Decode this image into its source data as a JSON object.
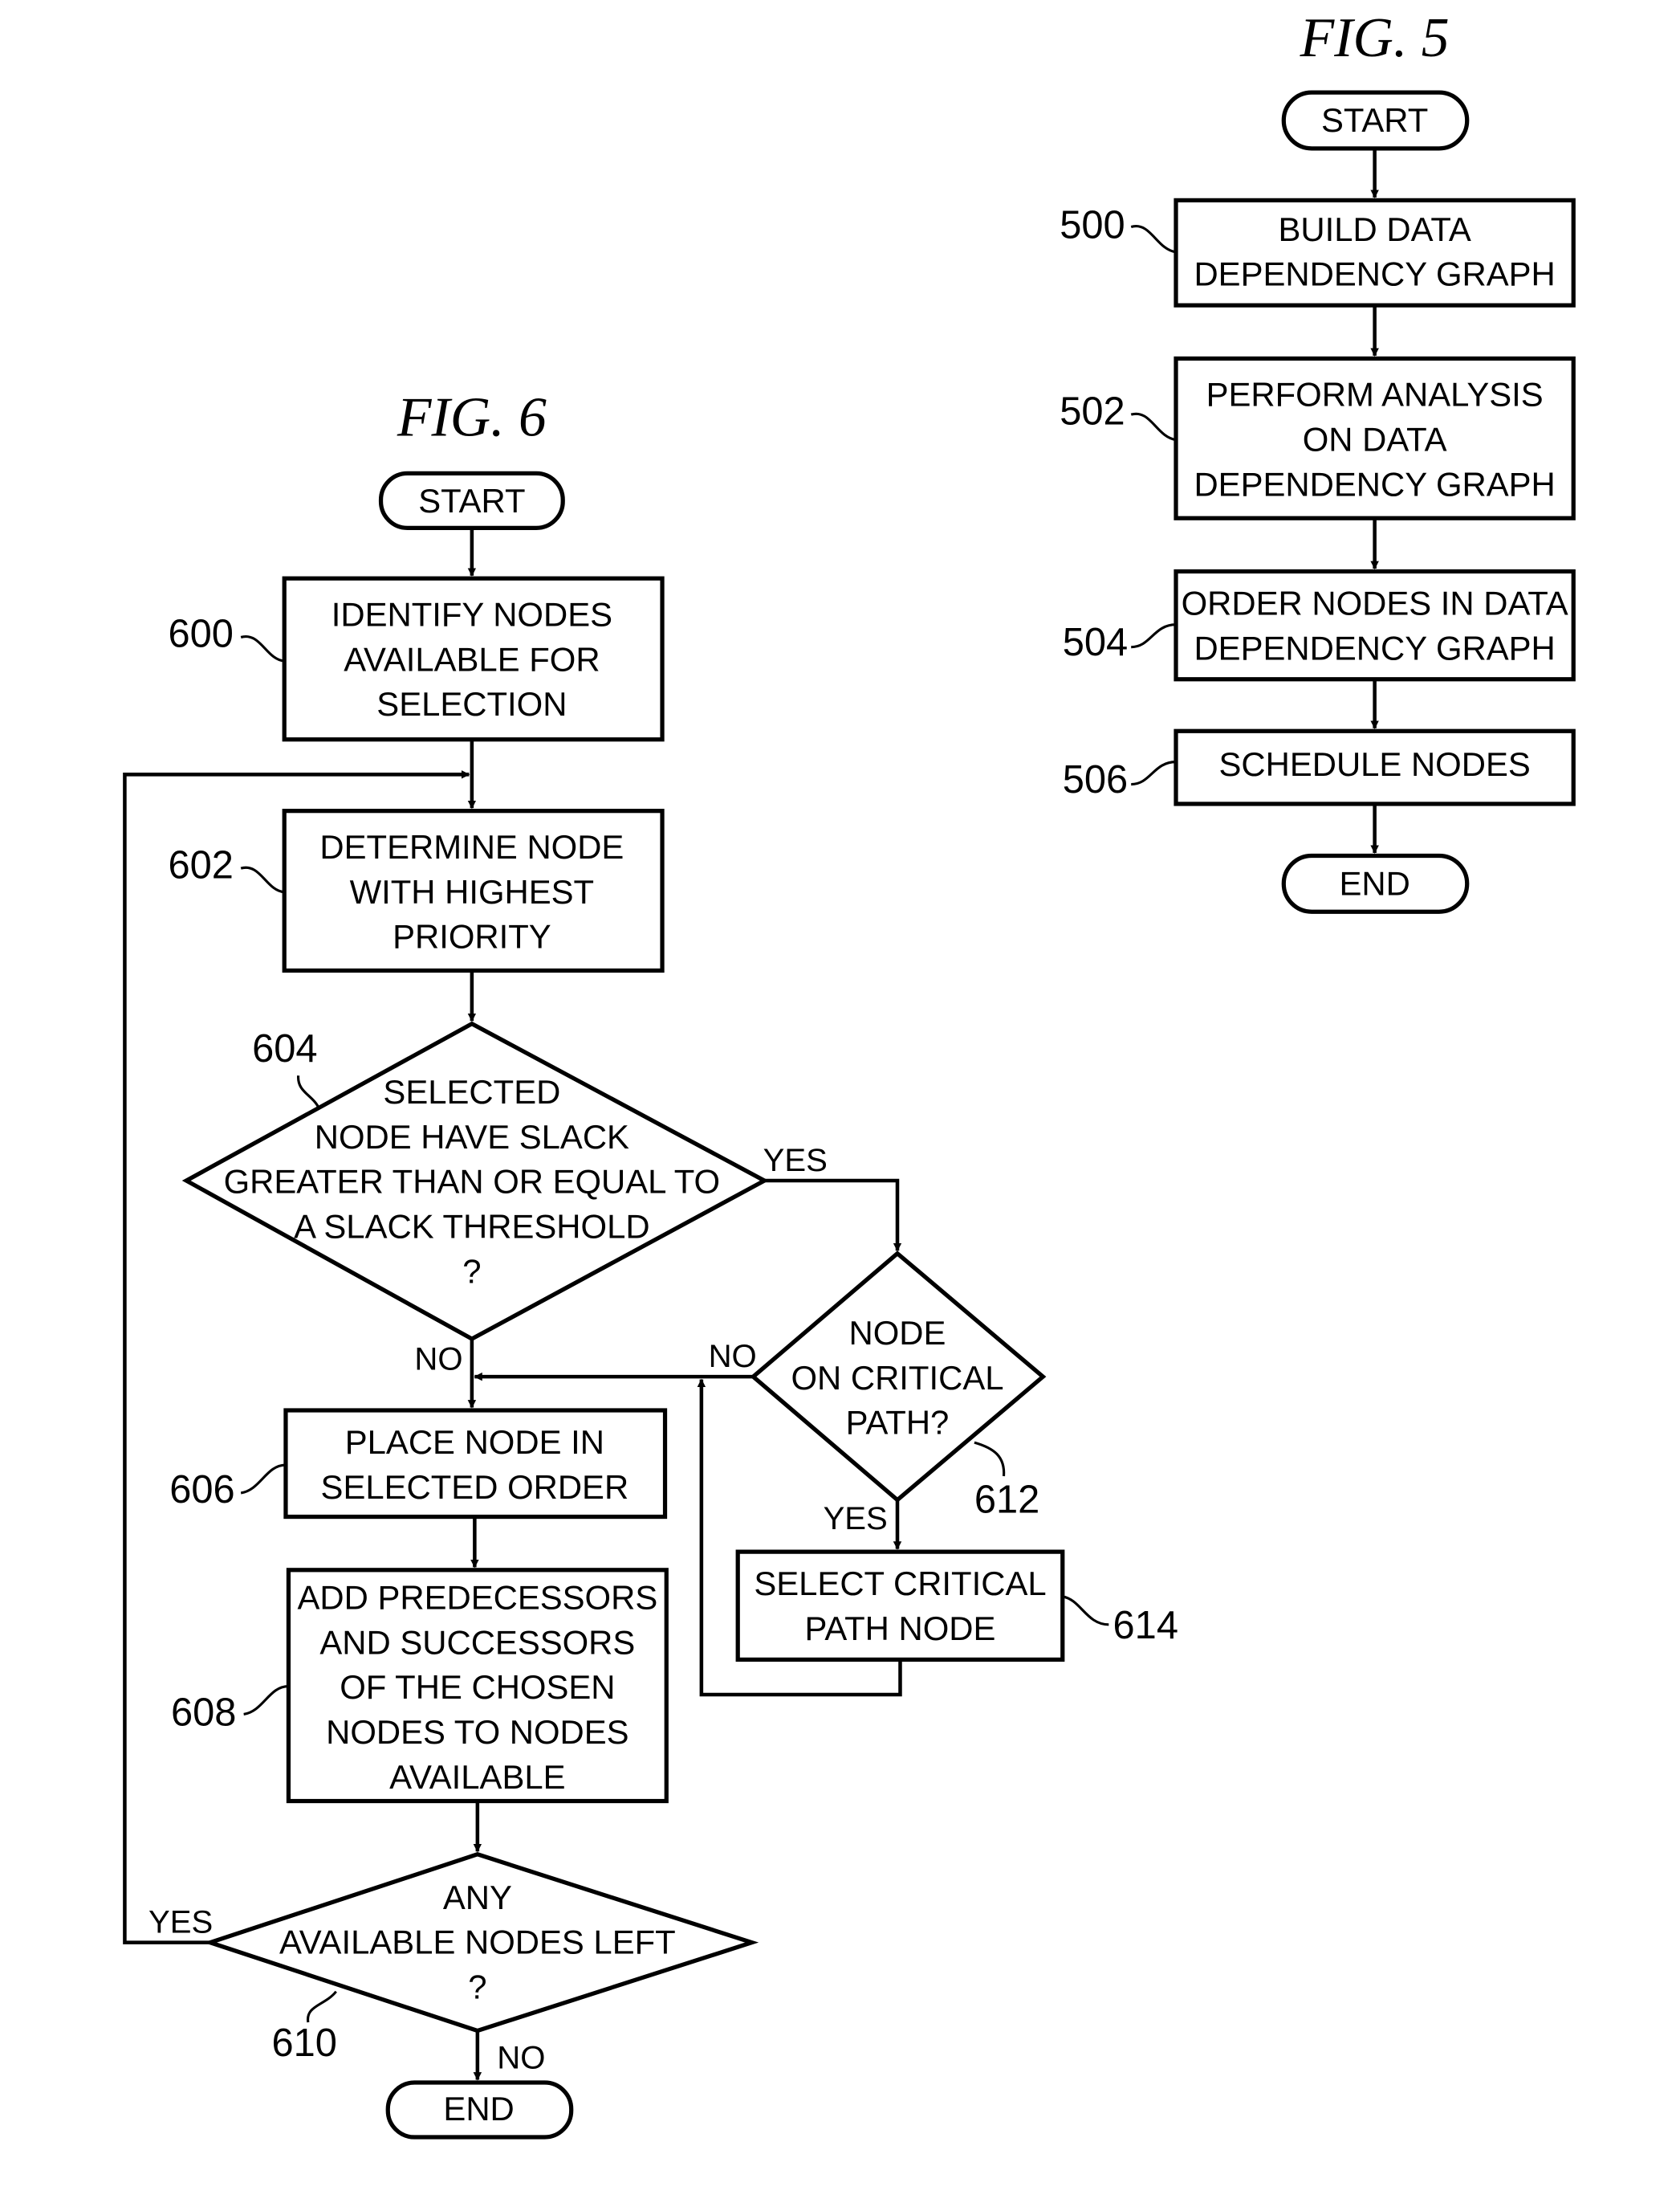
{
  "fig5": {
    "title": "FIG. 5",
    "start": "START",
    "end": "END",
    "steps": [
      {
        "ref": "500",
        "lines": [
          "BUILD DATA",
          "DEPENDENCY GRAPH"
        ]
      },
      {
        "ref": "502",
        "lines": [
          "PERFORM ANALYSIS",
          "ON DATA",
          "DEPENDENCY GRAPH"
        ]
      },
      {
        "ref": "504",
        "lines": [
          "ORDER NODES IN DATA",
          "DEPENDENCY GRAPH"
        ]
      },
      {
        "ref": "506",
        "lines": [
          "SCHEDULE NODES"
        ]
      }
    ]
  },
  "fig6": {
    "title": "FIG. 6",
    "start": "START",
    "end": "END",
    "n600": {
      "ref": "600",
      "lines": [
        "IDENTIFY NODES",
        "AVAILABLE FOR",
        "SELECTION"
      ]
    },
    "n602": {
      "ref": "602",
      "lines": [
        "DETERMINE NODE",
        "WITH HIGHEST",
        "PRIORITY"
      ]
    },
    "n604": {
      "ref": "604",
      "lines": [
        "SELECTED",
        "NODE HAVE SLACK",
        "GREATER THAN OR EQUAL TO",
        "A SLACK THRESHOLD",
        "?"
      ]
    },
    "n606": {
      "ref": "606",
      "lines": [
        "PLACE NODE IN",
        "SELECTED ORDER"
      ]
    },
    "n608": {
      "ref": "608",
      "lines": [
        "ADD PREDECESSORS",
        "AND SUCCESSORS",
        "OF THE CHOSEN",
        "NODES TO NODES",
        "AVAILABLE"
      ]
    },
    "n610": {
      "ref": "610",
      "lines": [
        "ANY",
        "AVAILABLE NODES LEFT",
        "?"
      ]
    },
    "n612": {
      "ref": "612",
      "lines": [
        "NODE",
        "ON CRITICAL",
        "PATH?"
      ]
    },
    "n614": {
      "ref": "614",
      "lines": [
        "SELECT CRITICAL",
        "PATH NODE"
      ]
    },
    "labels": {
      "yes_604": "YES",
      "no_604": "NO",
      "no_612": "NO",
      "yes_612": "YES",
      "yes_610": "YES",
      "no_610": "NO"
    }
  }
}
